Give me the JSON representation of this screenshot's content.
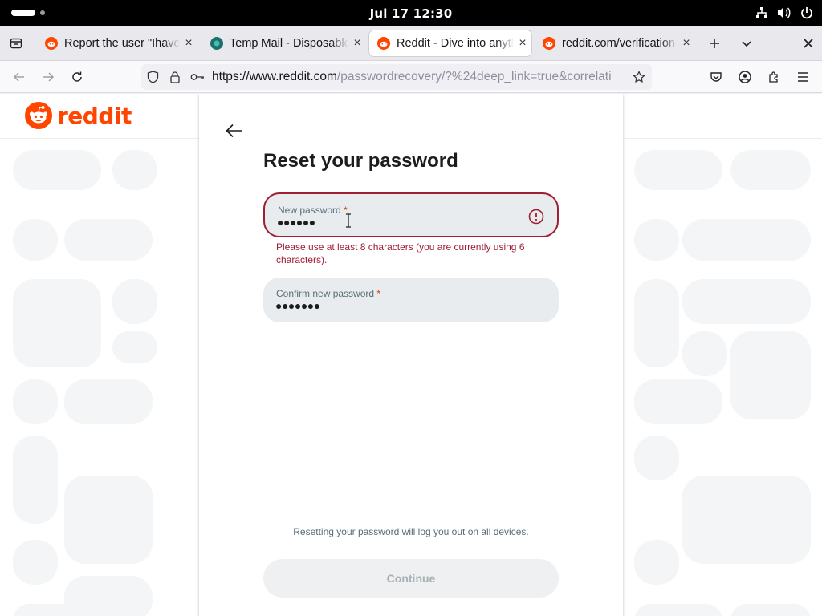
{
  "system_bar": {
    "clock": "Jul 17  12:30",
    "icons": [
      "network-icon",
      "volume-icon",
      "power-icon"
    ]
  },
  "browser": {
    "tabs": [
      {
        "title": "Report the user \"Ihave",
        "favicon": "reddit-icon",
        "active": false
      },
      {
        "title": "Temp Mail - Disposable",
        "favicon": "tempmail-icon",
        "active": false
      },
      {
        "title": "Reddit - Dive into anyth",
        "favicon": "reddit-icon",
        "active": true
      },
      {
        "title": "reddit.com/verification",
        "favicon": "reddit-icon",
        "active": false
      }
    ],
    "url_host": "https://www.reddit.com",
    "url_path": "/passwordrecovery/?%24deep_link=true&correlati"
  },
  "site": {
    "logo_text": "reddit",
    "brand_color": "#ff4500"
  },
  "form": {
    "title": "Reset your password",
    "new_password": {
      "label": "New password",
      "required_mark": "*",
      "value": "●●●●●●",
      "error": "Please use at least 8 characters (you are currently using 6 characters)."
    },
    "confirm_password": {
      "label": "Confirm new password",
      "required_mark": "*",
      "value": "●●●●●●●"
    },
    "note": "Resetting your password will log you out on all devices.",
    "submit_label": "Continue",
    "error_color": "#a11d33"
  }
}
